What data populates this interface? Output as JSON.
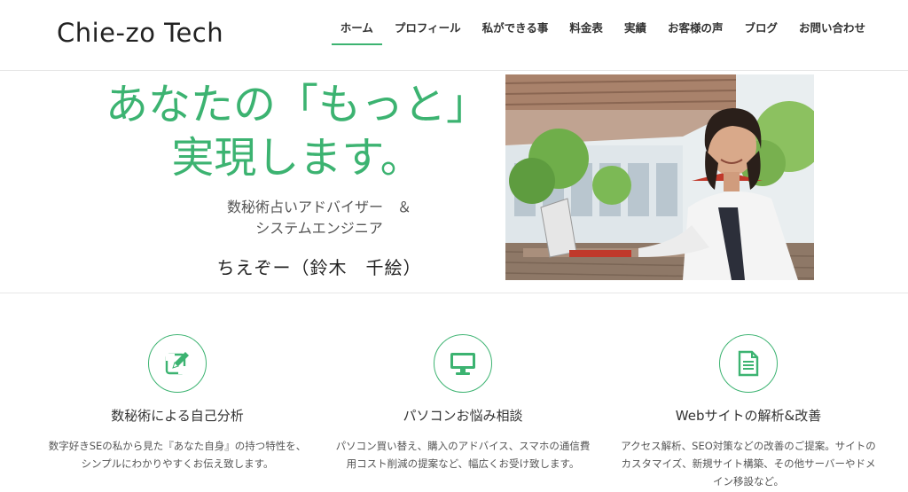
{
  "header": {
    "logo": "Chie-zo Tech",
    "nav": [
      {
        "label": "ホーム",
        "active": true
      },
      {
        "label": "プロフィール"
      },
      {
        "label": "私ができる事"
      },
      {
        "label": "料金表"
      },
      {
        "label": "実績"
      },
      {
        "label": "お客様の声"
      },
      {
        "label": "ブログ"
      },
      {
        "label": "お問い合わせ"
      }
    ]
  },
  "hero": {
    "title_line1": "あなたの「もっと」",
    "title_line2": "実現します。",
    "subtitle_line1": "数秘術占いアドバイザー　＆",
    "subtitle_line2": "システムエンジニア",
    "name": "ちえぞー（鈴木　千絵）"
  },
  "services": [
    {
      "icon": "pencil-edit-icon",
      "title": "数秘術による自己分析",
      "desc_line1": "数字好きSEの私から見た『あなた自身』の持つ特性を、",
      "desc_line2": "シンプルにわかりやすくお伝え致します。"
    },
    {
      "icon": "monitor-icon",
      "title": "パソコンお悩み相談",
      "desc_line1": "パソコン買い替え、購入のアドバイス、スマホの通信費",
      "desc_line2": "用コスト削減の提案など、幅広くお受け致します。"
    },
    {
      "icon": "document-icon",
      "title": "Webサイトの解析&改善",
      "desc_line1": "アクセス解析、SEO対策などの改善のご提案。サイトの",
      "desc_line2": "カスタマイズ、新規サイト構築、その他サーバーやドメ",
      "desc_line3": "イン移設など。"
    }
  ],
  "colors": {
    "accent": "#3cb371",
    "text": "#333333"
  }
}
